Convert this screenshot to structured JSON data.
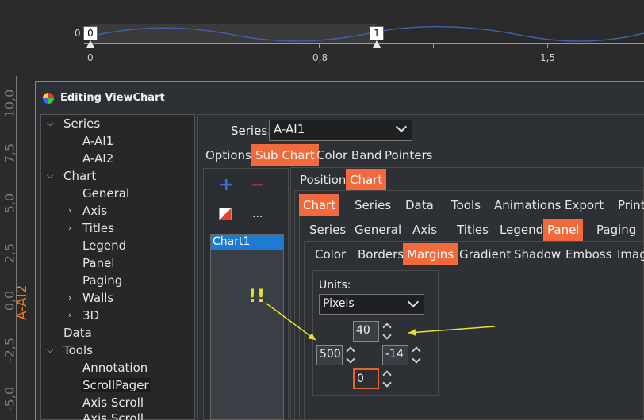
{
  "pager": {
    "start_handle": "0",
    "end_handle": "1",
    "left_label": "0",
    "ticks": [
      "0",
      "0,8",
      "1,5"
    ]
  },
  "background_chart": {
    "y_ticks": [
      "10,0",
      "7,5",
      "5,0",
      "2,5",
      "0,0",
      "-2,5",
      "-5,0"
    ],
    "series_title": "A-AI2",
    "accent_color": "#e87a2a"
  },
  "dialog": {
    "title": "Editing ViewChart"
  },
  "tree": {
    "items": [
      {
        "label": "Series",
        "chevron": "down"
      },
      {
        "label": "A-AI1"
      },
      {
        "label": "A-AI2"
      },
      {
        "label": "Chart",
        "chevron": "down"
      },
      {
        "label": "General"
      },
      {
        "label": "Axis",
        "chevron": "right"
      },
      {
        "label": "Titles",
        "chevron": "right"
      },
      {
        "label": "Legend"
      },
      {
        "label": "Panel"
      },
      {
        "label": "Paging"
      },
      {
        "label": "Walls",
        "chevron": "right"
      },
      {
        "label": "3D",
        "chevron": "right"
      },
      {
        "label": "Data"
      },
      {
        "label": "Tools",
        "chevron": "down"
      },
      {
        "label": "Annotation"
      },
      {
        "label": "ScrollPager"
      },
      {
        "label": "Axis Scroll"
      },
      {
        "label": "Axis Scroll"
      }
    ]
  },
  "series": {
    "label": "Series:",
    "selected": "A-AI1"
  },
  "tabs_level1": [
    "Options",
    "Sub Chart",
    "Color Band",
    "Pointers"
  ],
  "tabs_level2": [
    "Position",
    "Chart"
  ],
  "tabs_level3": [
    "Chart",
    "Series",
    "Data",
    "Tools",
    "Animations",
    "Export",
    "Print"
  ],
  "tabs_level4": [
    "Series",
    "General",
    "Axis",
    "Titles",
    "Legend",
    "Panel",
    "Paging"
  ],
  "tabs_level5": [
    "Color",
    "Borders",
    "Margins",
    "Gradient",
    "Shadow",
    "Emboss",
    "Image"
  ],
  "chart_list": {
    "add_icon": "plus-icon",
    "remove_icon": "minus-icon",
    "more_label": "...",
    "items": [
      "Chart1"
    ]
  },
  "margins": {
    "units_label": "Units:",
    "units_value": "Pixels",
    "top": "40",
    "left": "500",
    "right": "-14",
    "bottom": "0"
  },
  "annotation": {
    "text": "!!",
    "color": "#e8e030"
  },
  "colors": {
    "accent": "#f26a3c",
    "selection": "#1e7bd4"
  }
}
